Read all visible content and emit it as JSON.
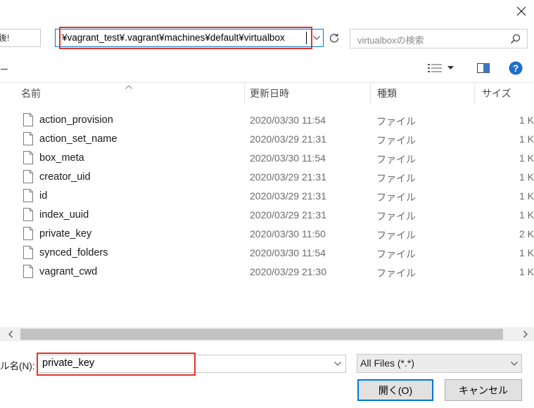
{
  "address_bar": {
    "left_fragment": "後!",
    "path": "¥vagrant_test¥.vagrant¥machines¥default¥virtualbox"
  },
  "search": {
    "placeholder": "virtualboxの検索"
  },
  "toolbar": {
    "left_fragment": "ー"
  },
  "columns": {
    "name": "名前",
    "modified": "更新日時",
    "type": "種類",
    "size": "サイズ"
  },
  "files": [
    {
      "name": "action_provision",
      "modified": "2020/03/30 11:54",
      "type": "ファイル",
      "size": "1 K"
    },
    {
      "name": "action_set_name",
      "modified": "2020/03/29 21:31",
      "type": "ファイル",
      "size": "1 K"
    },
    {
      "name": "box_meta",
      "modified": "2020/03/30 11:54",
      "type": "ファイル",
      "size": "1 K"
    },
    {
      "name": "creator_uid",
      "modified": "2020/03/29 21:31",
      "type": "ファイル",
      "size": "1 K"
    },
    {
      "name": "id",
      "modified": "2020/03/29 21:31",
      "type": "ファイル",
      "size": "1 K"
    },
    {
      "name": "index_uuid",
      "modified": "2020/03/29 21:31",
      "type": "ファイル",
      "size": "1 K"
    },
    {
      "name": "private_key",
      "modified": "2020/03/30 11:50",
      "type": "ファイル",
      "size": "2 K"
    },
    {
      "name": "synced_folders",
      "modified": "2020/03/30 11:54",
      "type": "ファイル",
      "size": "1 K"
    },
    {
      "name": "vagrant_cwd",
      "modified": "2020/03/29 21:30",
      "type": "ファイル",
      "size": "1 K"
    }
  ],
  "filename_field": {
    "label": "ル名(N):",
    "value": "private_key"
  },
  "filetype": {
    "selected": "All Files (*.*)"
  },
  "buttons": {
    "open": "開く(O)",
    "cancel": "キャンセル"
  },
  "colors": {
    "highlight": "#e0352b",
    "focus_blue": "#0078d7",
    "help_blue": "#1a6fc9"
  },
  "icons": {
    "close": "close-icon",
    "dropdown": "chevron-down-icon",
    "refresh": "refresh-icon",
    "search": "search-icon",
    "view": "list-view-icon",
    "preview": "preview-pane-icon",
    "help": "help-icon",
    "file": "file-icon"
  }
}
